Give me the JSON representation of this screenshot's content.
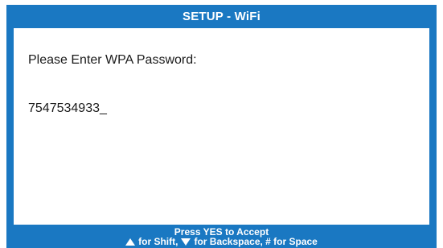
{
  "window": {
    "title": "SETUP - WiFi"
  },
  "form": {
    "prompt": "Please Enter WPA Password:",
    "password_value": "7547534933_"
  },
  "footer": {
    "accept_hint": "Press YES to Accept",
    "shift_hint": "for Shift,",
    "backspace_hint": "for Backspace, # for Space",
    "up_icon": "triangle-up-icon",
    "down_icon": "triangle-down-icon"
  },
  "colors": {
    "frame_blue": "#1a78c2",
    "background": "#ffffff",
    "text": "#1a1a1a"
  }
}
